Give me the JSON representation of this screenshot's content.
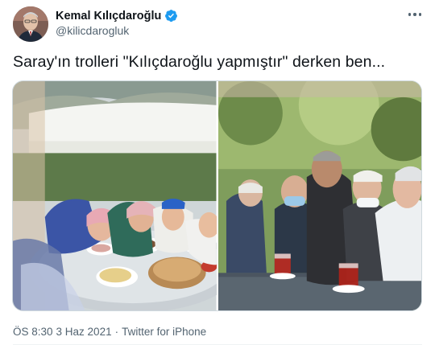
{
  "author": {
    "display_name": "Kemal Kılıçdaroğlu",
    "handle": "@kilicdarogluk",
    "verified": true
  },
  "tweet": {
    "text": "Saray'ın trolleri \"Kılıçdaroğlu yapmıştır\" derken ben..."
  },
  "meta": {
    "time": "ÖS 8:30",
    "separator": "·",
    "date": "3 Haz 2021",
    "source": "Twitter for iPhone"
  },
  "icons": {
    "verified": "verified-badge-icon",
    "more": "more-options-icon"
  },
  "colors": {
    "verified_blue": "#1d9bf0",
    "secondary_text": "#536471"
  }
}
